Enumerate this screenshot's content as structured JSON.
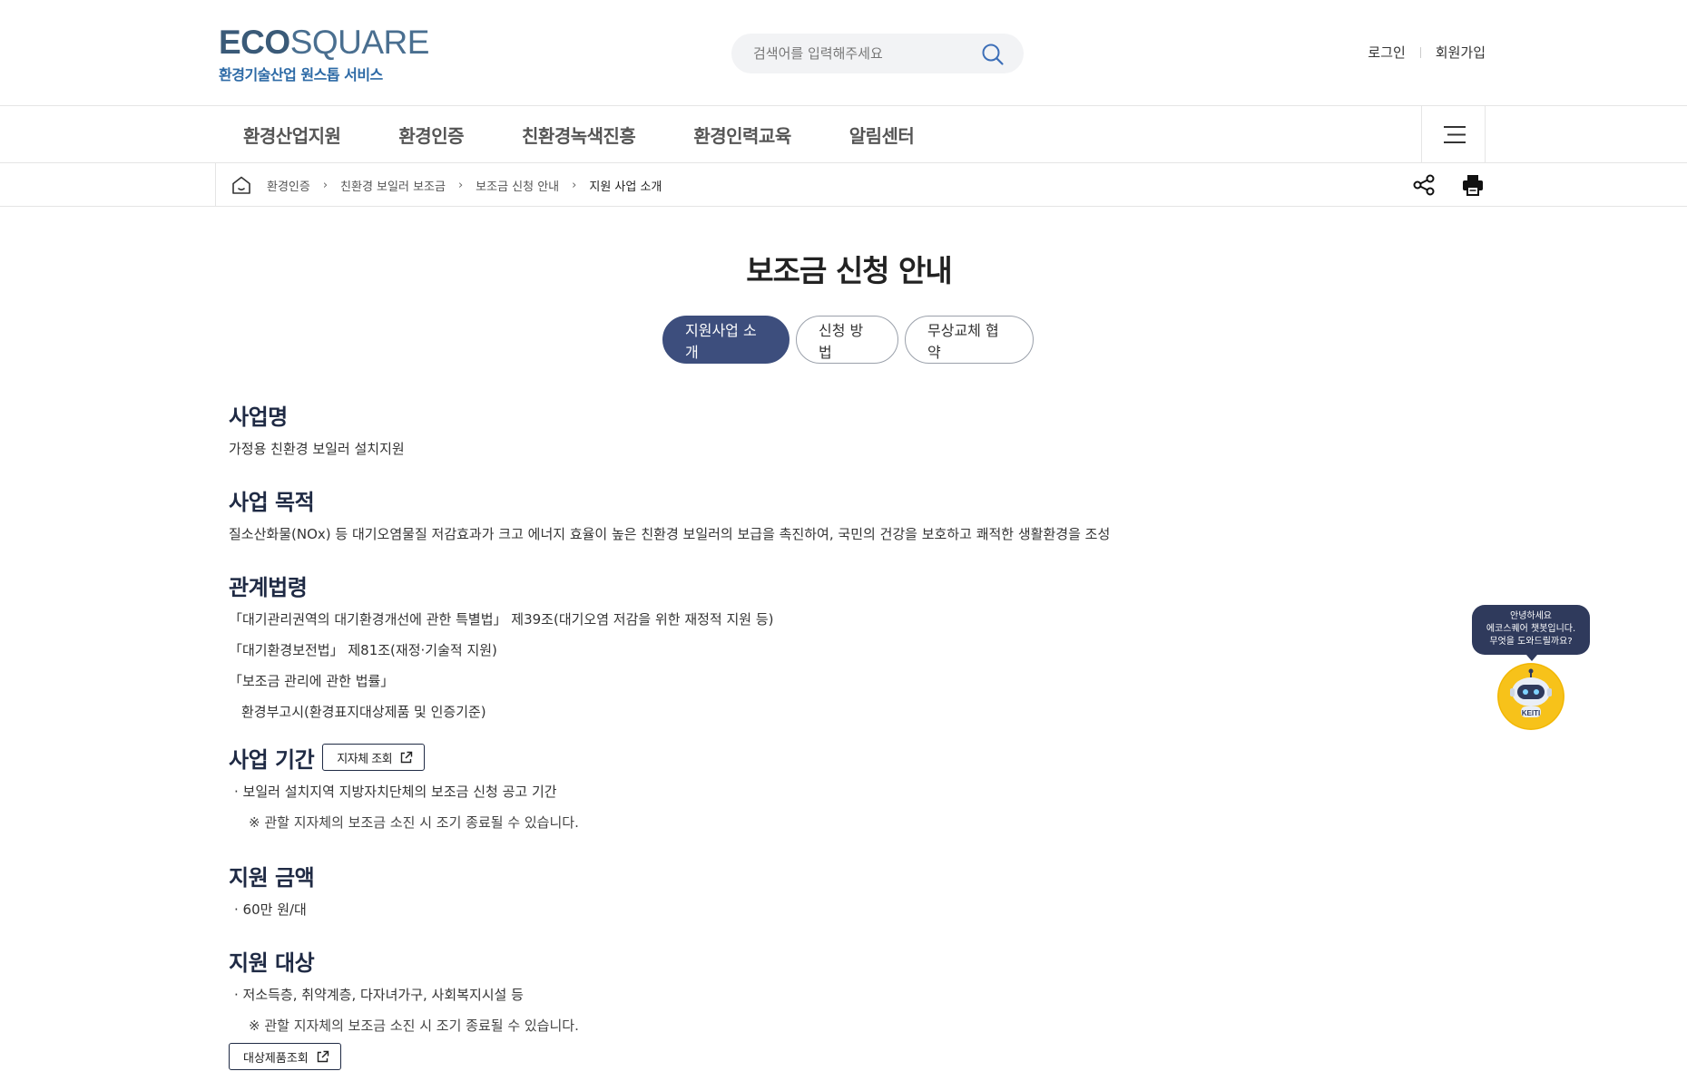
{
  "logo": {
    "brand_bold": "ECO",
    "brand_light": "SQUARE",
    "tagline": "환경기술산업 원스톱 서비스"
  },
  "search": {
    "placeholder": "검색어를 입력해주세요",
    "icon": "search-icon"
  },
  "util": {
    "login": "로그인",
    "signup": "회원가입"
  },
  "gnb": {
    "items": [
      "환경산업지원",
      "환경인증",
      "친환경녹색진흥",
      "환경인력교육",
      "알림센터"
    ],
    "menu_icon": "hamburger-icon"
  },
  "breadcrumb": {
    "home_icon": "home-icon",
    "items": [
      "환경인증",
      "친환경 보일러 보조금",
      "보조금 신청 안내",
      "지원 사업 소개"
    ],
    "separator": ">"
  },
  "tools": {
    "share_icon": "share-icon",
    "print_icon": "print-icon"
  },
  "page_title": "보조금 신청 안내",
  "tabs": [
    {
      "label": "지원사업 소개",
      "active": true
    },
    {
      "label": "신청 방법",
      "active": false
    },
    {
      "label": "무상교체 협약",
      "active": false
    }
  ],
  "sections": {
    "name": {
      "title": "사업명",
      "text": "가정용 친환경 보일러 설치지원"
    },
    "purpose": {
      "title": "사업 목적",
      "text": "질소산화물(NOx) 등 대기오염물질 저감효과가 크고 에너지 효율이 높은 친환경 보일러의 보급을 촉진하여, 국민의 건강을 보호하고 쾌적한 생활환경을 조성"
    },
    "laws": {
      "title": "관계법령",
      "items": [
        "「대기관리권역의 대기환경개선에 관한 특별법」 제39조(대기오염 저감을 위한 재정적 지원 등)",
        "「대기환경보전법」 제81조(재정·기술적 지원)",
        "「보조금 관리에 관한 법률」",
        "환경부고시(환경표지대상제품 및 인증기준)"
      ]
    },
    "period": {
      "title": "사업 기간",
      "button": "지자체 조회",
      "bullet": "· 보일러 설치지역 지방자치단체의 보조금 신청 공고 기간",
      "note": "※ 관할 지자체의 보조금 소진 시 조기 종료될 수 있습니다."
    },
    "amount": {
      "title": "지원 금액",
      "bullet": "· 60만 원/대"
    },
    "target": {
      "title": "지원 대상",
      "bullet": "· 저소득층, 취약계층, 다자녀가구, 사회복지시설 등",
      "note": "※ 관할 지자체의 보조금 소진 시 조기 종료될 수 있습니다.",
      "button": "대상제품조회"
    }
  },
  "chatbot": {
    "line1": "안녕하세요",
    "line2": "에코스퀘어 챗봇입니다.",
    "line3": "무엇을 도와드릴까요?",
    "badge": "KEITI"
  },
  "colors": {
    "navy": "#3d4e7d",
    "title": "#1f2a44",
    "bot_yellow": "#f7c21a",
    "bubble": "#2f3a5c"
  }
}
